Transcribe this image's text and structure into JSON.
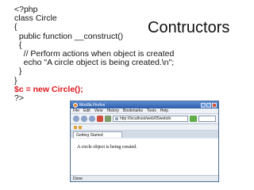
{
  "slide": {
    "title": "Contructors",
    "code_lines": [
      "<?php",
      "class Circle",
      "{",
      "  public function __construct()",
      "  {",
      "    // Perform actions when object is created",
      "    echo \"A circle object is being created.\\n\";",
      "  }",
      "}",
      "$c = new Circle();",
      "?>"
    ],
    "highlight_color": "#e0151b"
  },
  "browser": {
    "window_title": "Mozilla Firefox",
    "menu": [
      "File",
      "Edit",
      "View",
      "History",
      "Bookmarks",
      "Tools",
      "Help"
    ],
    "url": "http://localhost/web/05webdn",
    "tab_label": "Getting Started",
    "page_text": "A circle object is being created.",
    "status": "Done"
  }
}
